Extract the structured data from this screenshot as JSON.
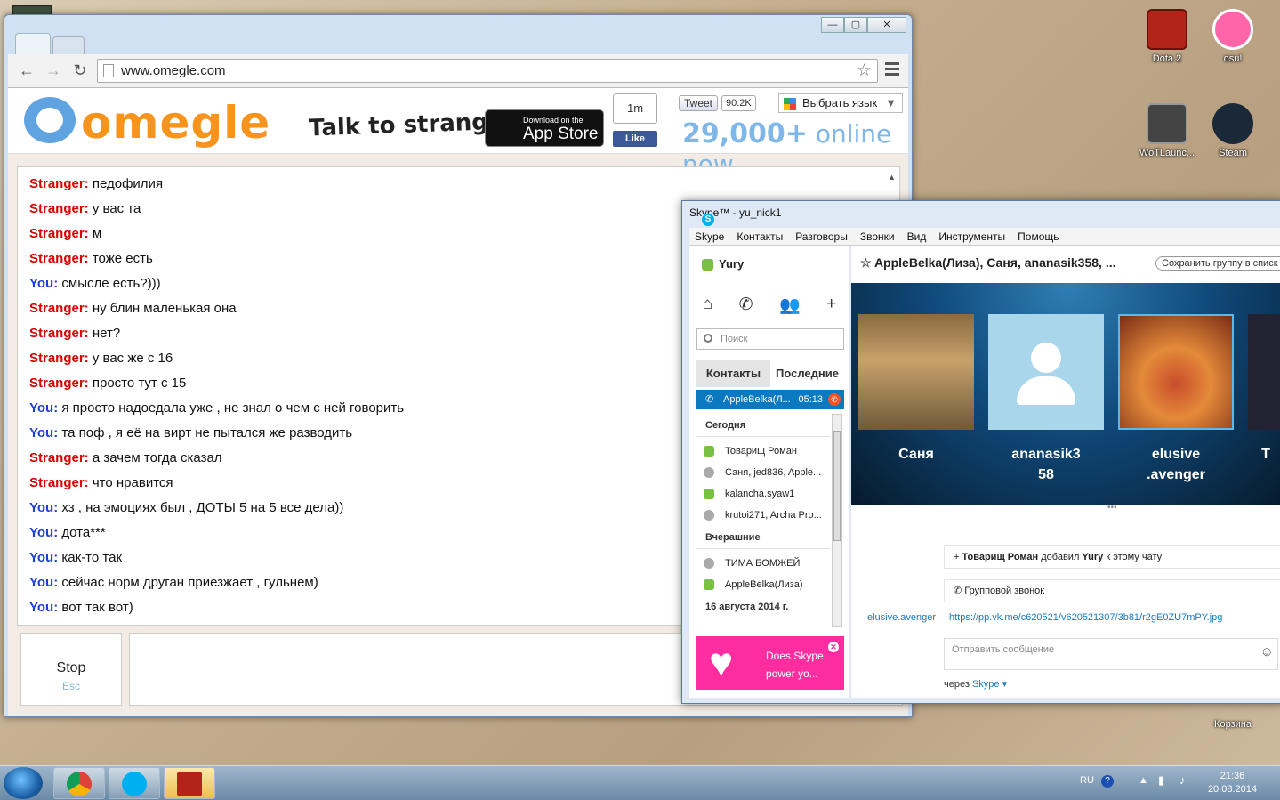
{
  "desktop": {
    "icons": [
      {
        "label": "Dota 2"
      },
      {
        "label": "osu!"
      },
      {
        "label": "WoTLaunc..."
      },
      {
        "label": "Steam"
      },
      {
        "label": "Корзина"
      }
    ]
  },
  "browser": {
    "url": "www.omegle.com",
    "window_buttons": {
      "minimize": "—",
      "maximize": "▢",
      "close": "✕"
    }
  },
  "omegle": {
    "logo": "omegle",
    "tagline": "Talk to strangers!",
    "appstore_small": "Download on the",
    "appstore_big": "App Store",
    "fb_count": "1m",
    "fb_like": "Like",
    "tweet_label": "Tweet",
    "tweet_count": "90.2K",
    "lang_label": "Выбрать язык",
    "online_count": "29,000+",
    "online_text": "online now",
    "messages": [
      {
        "who": "Stranger:",
        "type": "s",
        "text": "педофилия"
      },
      {
        "who": "Stranger:",
        "type": "s",
        "text": "у вас та"
      },
      {
        "who": "Stranger:",
        "type": "s",
        "text": "м"
      },
      {
        "who": "Stranger:",
        "type": "s",
        "text": "тоже есть"
      },
      {
        "who": "You:",
        "type": "y",
        "text": "смысле есть?)))"
      },
      {
        "who": "Stranger:",
        "type": "s",
        "text": "ну блин маленькая она"
      },
      {
        "who": "Stranger:",
        "type": "s",
        "text": "нет?"
      },
      {
        "who": "Stranger:",
        "type": "s",
        "text": "у вас же с 16"
      },
      {
        "who": "Stranger:",
        "type": "s",
        "text": "просто тут с 15"
      },
      {
        "who": "You:",
        "type": "y",
        "text": "я просто надоедала уже , не знал о чем с ней говорить"
      },
      {
        "who": "You:",
        "type": "y",
        "text": "та поф , я её на вирт не пытался же разводить"
      },
      {
        "who": "Stranger:",
        "type": "s",
        "text": "а зачем тогда сказал"
      },
      {
        "who": "Stranger:",
        "type": "s",
        "text": "что нравится"
      },
      {
        "who": "You:",
        "type": "y",
        "text": "хз , на эмоциях был , ДОТЫ 5 на 5 все дела))"
      },
      {
        "who": "You:",
        "type": "y",
        "text": "дота***"
      },
      {
        "who": "You:",
        "type": "y",
        "text": "как-то так"
      },
      {
        "who": "You:",
        "type": "y",
        "text": "сейчас норм друган приезжает , гульнем)"
      },
      {
        "who": "You:",
        "type": "y",
        "text": "вот так вот)"
      }
    ],
    "stop_label": "Stop",
    "stop_key": "Esc"
  },
  "skype": {
    "title": "Skype™ - yu_nick1",
    "menu": [
      "Skype",
      "Контакты",
      "Разговоры",
      "Звонки",
      "Вид",
      "Инструменты",
      "Помощь"
    ],
    "user": "Yury",
    "search_placeholder": "Поиск",
    "tabs": [
      "Контакты",
      "Последние"
    ],
    "active_call": {
      "name": "AppleBelka(Л...",
      "time": "05:13"
    },
    "sections": [
      {
        "title": "Сегодня",
        "items": [
          {
            "name": "Товарищ Роман",
            "kind": "on"
          },
          {
            "name": "Саня, jed836, Apple...",
            "kind": "grp"
          },
          {
            "name": "kalancha.syaw1",
            "kind": "on"
          },
          {
            "name": "krutoi271, Archa Pro...",
            "kind": "grp"
          }
        ]
      },
      {
        "title": "Вчерашние",
        "items": [
          {
            "name": "ТИМА БОМЖЕЙ",
            "kind": "grp"
          },
          {
            "name": "AppleBelka(Лиза)",
            "kind": "on"
          }
        ]
      },
      {
        "title": "16 августа 2014 г.",
        "items": []
      }
    ],
    "ad_text_1": "Does Skype",
    "ad_text_2": "power yo...",
    "conversation_title": "AppleBelka(Лиза), Саня, ananasik358, ...",
    "save_group": "Сохранить группу в списк",
    "participants": [
      {
        "line1": "Саня",
        "line2": ""
      },
      {
        "line1": "ananasik3",
        "line2": "58"
      },
      {
        "line1": "elusive",
        "line2": ".avenger"
      },
      {
        "line1": "T",
        "line2": ""
      }
    ],
    "event1_bold1": "Товарищ Роман",
    "event1_mid": "добавил",
    "event1_bold2": "Yury",
    "event1_tail": "к этому чату",
    "event2": "Групповой звонок",
    "sender": "elusive.avenger",
    "link": "https://pp.vk.me/c620521/v620521307/3b81/r2gE0ZU7mPY.jpg",
    "input_placeholder": "Отправить сообщение",
    "via_label": "через",
    "via_link": "Skype"
  },
  "taskbar": {
    "lang": "RU",
    "time": "21:36",
    "date": "20.08.2014"
  }
}
